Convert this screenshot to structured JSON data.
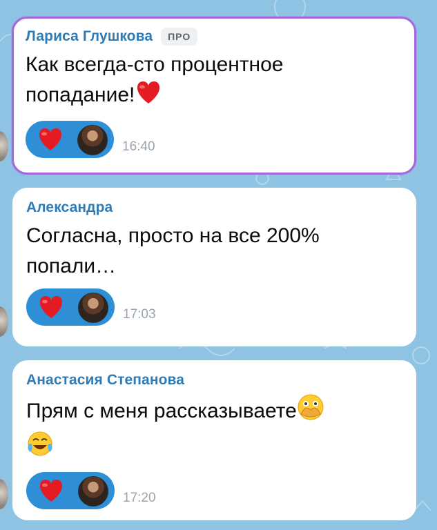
{
  "messages": [
    {
      "author": "Лариса Глушкова",
      "badge": "ПРО",
      "line1": "Как всегда-сто процентное",
      "line2": "попадание!",
      "trailing_emoji": "red-heart",
      "reaction": "red-heart",
      "time": "16:40",
      "highlighted": true
    },
    {
      "author": "Александра",
      "line1": "Согласна, просто на все 200%",
      "line2": "попали…",
      "reaction": "red-heart",
      "time": "17:03"
    },
    {
      "author": "Анастасия Степанова",
      "line1": "Прям с меня рассказываете",
      "trailing_emoji": "face-with-open-eyes-and-hand-over-mouth",
      "line2_emoji": "face-with-tears-of-joy",
      "reaction": "red-heart",
      "time": "17:20"
    }
  ],
  "colors": {
    "background": "#8fc3e3",
    "author": "#2f7bb5",
    "highlight_border": "#a767dc",
    "reaction_pill": "#2f8fd6",
    "time": "#9aa4ad"
  }
}
